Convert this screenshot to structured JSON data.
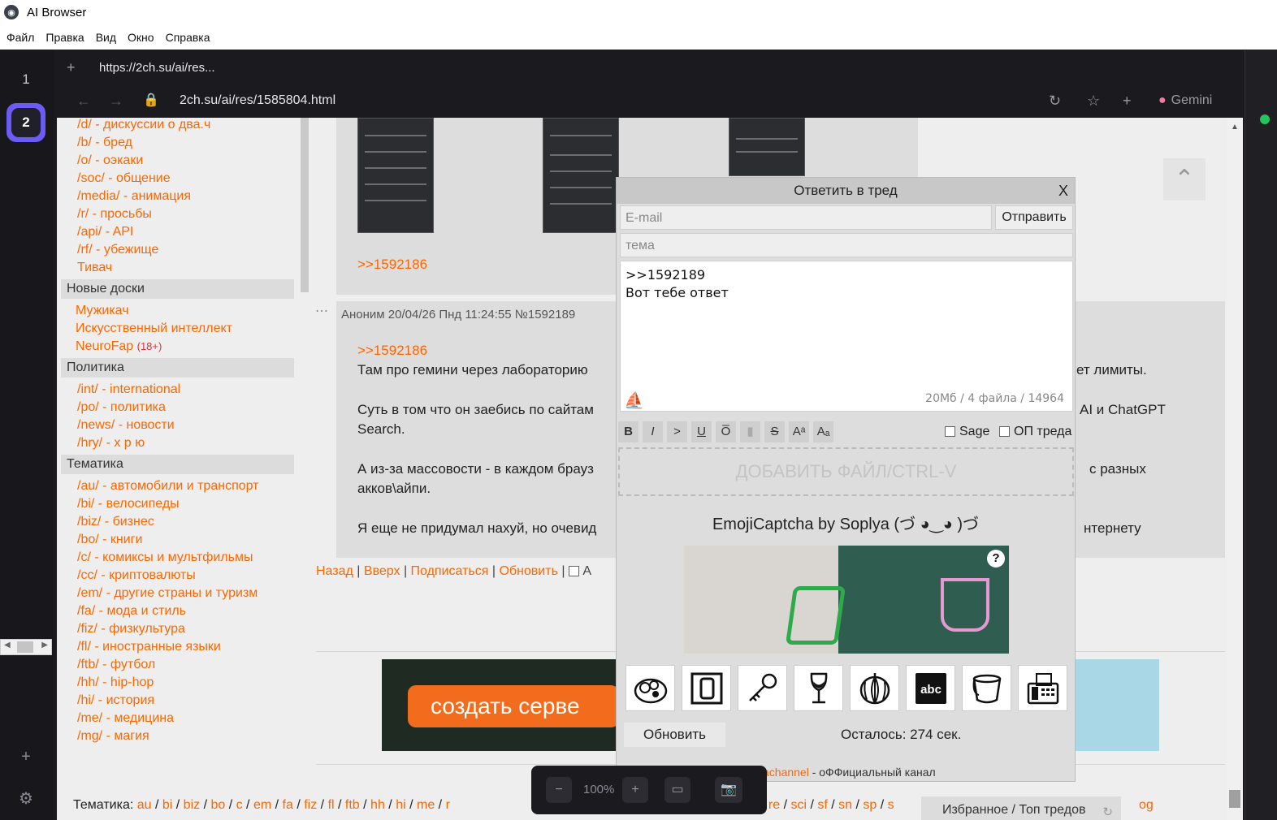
{
  "app": {
    "title": "AI Browser"
  },
  "menu": [
    "Файл",
    "Правка",
    "Вид",
    "Окно",
    "Справка"
  ],
  "workspaces": [
    "1",
    "2"
  ],
  "tab": {
    "title": "https://2ch.su/ai/res..."
  },
  "address": {
    "url": "2ch.su/ai/res/1585804.html",
    "assistant": "Gemini"
  },
  "sidebar": {
    "boards_top": [
      "/d/ - дискуссии о два.ч",
      "/b/ - бред",
      "/o/ - оэкаки",
      "/soc/ - общение",
      "/media/ - анимация",
      "/r/ - просьбы",
      "/api/ - API",
      "/rf/ - убежище",
      "Тивач"
    ],
    "new_title": "Новые доски",
    "new_boards": [
      "Мужикач",
      "Искусственный интеллект",
      "NeuroFap"
    ],
    "neurofap_badge": "(18+)",
    "politics_title": "Политика",
    "politics": [
      "/int/ - international",
      "/po/ - политика",
      "/news/ - новости",
      "/hry/ - х р ю"
    ],
    "topics_title": "Тематика",
    "topics": [
      "/au/ - автомобили и транспорт",
      "/bi/ - велосипеды",
      "/biz/ - бизнес",
      "/bo/ - книги",
      "/c/ - комиксы и мультфильмы",
      "/cc/ - криптовалюты",
      "/em/ - другие страны и туризм",
      "/fa/ - мода и стиль",
      "/fiz/ - физкультура",
      "/fl/ - иностранные языки",
      "/ftb/ - футбол",
      "/hh/ - hip-hop",
      "/hi/ - история",
      "/me/ - медицина",
      "/mg/ - магия"
    ]
  },
  "thread": {
    "prev_reflink": ">>1592186",
    "post": {
      "author": "Аноним",
      "date": "20/04/26 Пнд 11:24:55",
      "num": "№1592189",
      "reflink": ">>1592186",
      "line1a": "Там про гемини через лабораторию",
      "line1b": "ет лимиты.",
      "line2a": "Суть в том что он заебись по сайтам",
      "line2b": "AI и ChatGPT",
      "line2c": "Search.",
      "line3a": "А из-за массовости - в каждом брауз",
      "line3b": "с разных",
      "line3c": "акков\\айпи.",
      "line4a": "Я еще не придумал нахуй, но очевид",
      "line4b": "нтернету"
    },
    "bottom_links": [
      "Назад",
      "Вверх",
      "Подписаться",
      "Обновить"
    ],
    "bottom_checkbox": "А"
  },
  "ad": {
    "button": "создать серве"
  },
  "reply_form": {
    "title": "Ответить в тред",
    "close": "X",
    "email_placeholder": "E-mail",
    "send": "Отправить",
    "subject_placeholder": "тема",
    "message": ">>1592189\nВот тебе ответ",
    "limits": "20Мб / 4 файла / 14964",
    "format_buttons": [
      "B",
      "I",
      ">",
      "U",
      "O̅",
      "▮",
      "S",
      "Aᵃ",
      "Aₐ"
    ],
    "sage": "Sage",
    "op": "ОП треда",
    "add_file": "ДОБАВИТЬ ФАЙЛ/CTRL-V",
    "captcha_title": "EmojiCaptcha by Soplya (づ ◕‿◕ )づ",
    "captcha_help": "?",
    "captcha_options": [
      "coconut-icon",
      "digit-zero-icon",
      "key-icon",
      "wine-glass-icon",
      "melon-icon",
      "abc-icon",
      "bucket-icon",
      "fax-icon"
    ],
    "refresh": "Обновить",
    "remaining": "Осталось: 274 сек.",
    "channel_link": "achannel",
    "channel_text": " - оФФициальный канал"
  },
  "footer": {
    "label": "Тематика:",
    "boards": [
      "au",
      "bi",
      "biz",
      "bo",
      "c",
      "em",
      "fa",
      "fiz",
      "fl",
      "ftb",
      "hh",
      "hi",
      "me",
      "r"
    ],
    "boards_right": [
      "re",
      "sci",
      "sf",
      "sn",
      "sp",
      "s"
    ],
    "tail": "og",
    "favorites": "Избранное / Топ тредов"
  },
  "zoom": {
    "level": "100%"
  }
}
